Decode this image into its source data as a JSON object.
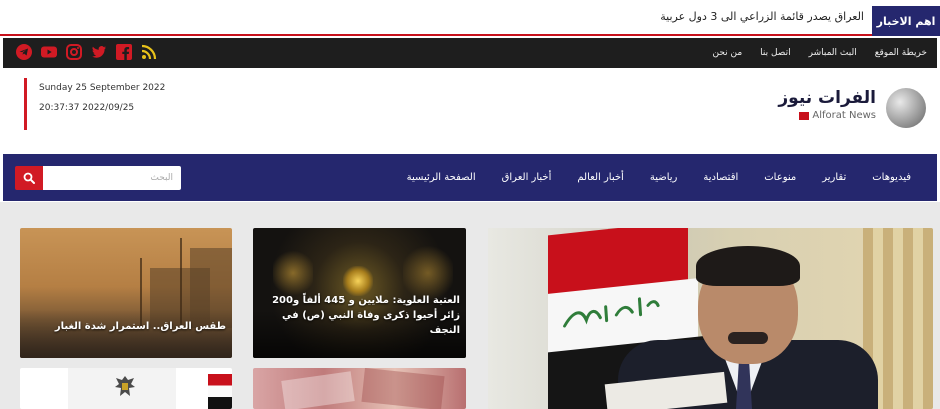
{
  "breaking": {
    "tag": "اهم الاخبار",
    "headline": "العراق يصدر قائمة الزراعي الى 3 دول عربية"
  },
  "topnav": {
    "links": [
      "من نحن",
      "اتصل بنا",
      "البث المباشر",
      "خريطة الموقع"
    ],
    "social": [
      "rss-icon",
      "facebook-icon",
      "twitter-icon",
      "instagram-icon",
      "youtube-icon",
      "telegram-icon"
    ]
  },
  "header": {
    "date": "Sunday 25 September 2022",
    "time": "20:37:37 2022/09/25",
    "logo_ar": "الفرات نيوز",
    "logo_en": "Alforat News"
  },
  "mainnav": {
    "items": [
      "الصفحة الرئيسية",
      "أخبار العراق",
      "أخبار العالم",
      "رياضية",
      "اقتصادية",
      "منوعات",
      "تقارير",
      "فيديوهات"
    ],
    "search_placeholder": "البحث"
  },
  "articles": [
    {
      "title": "طقس العراق.. استمرار شدة الغبار"
    },
    {
      "title": "العتبة العلوية: ملايين و 445 ألفاً و200 زائر أحيوا ذكرى وفاة النبي (ص) في النجف"
    },
    {
      "title": ""
    },
    {
      "title": ""
    },
    {
      "title": ""
    }
  ],
  "colors": {
    "navy": "#25276e",
    "accent_red": "#d11a24",
    "topbar": "#1e1e1e"
  }
}
